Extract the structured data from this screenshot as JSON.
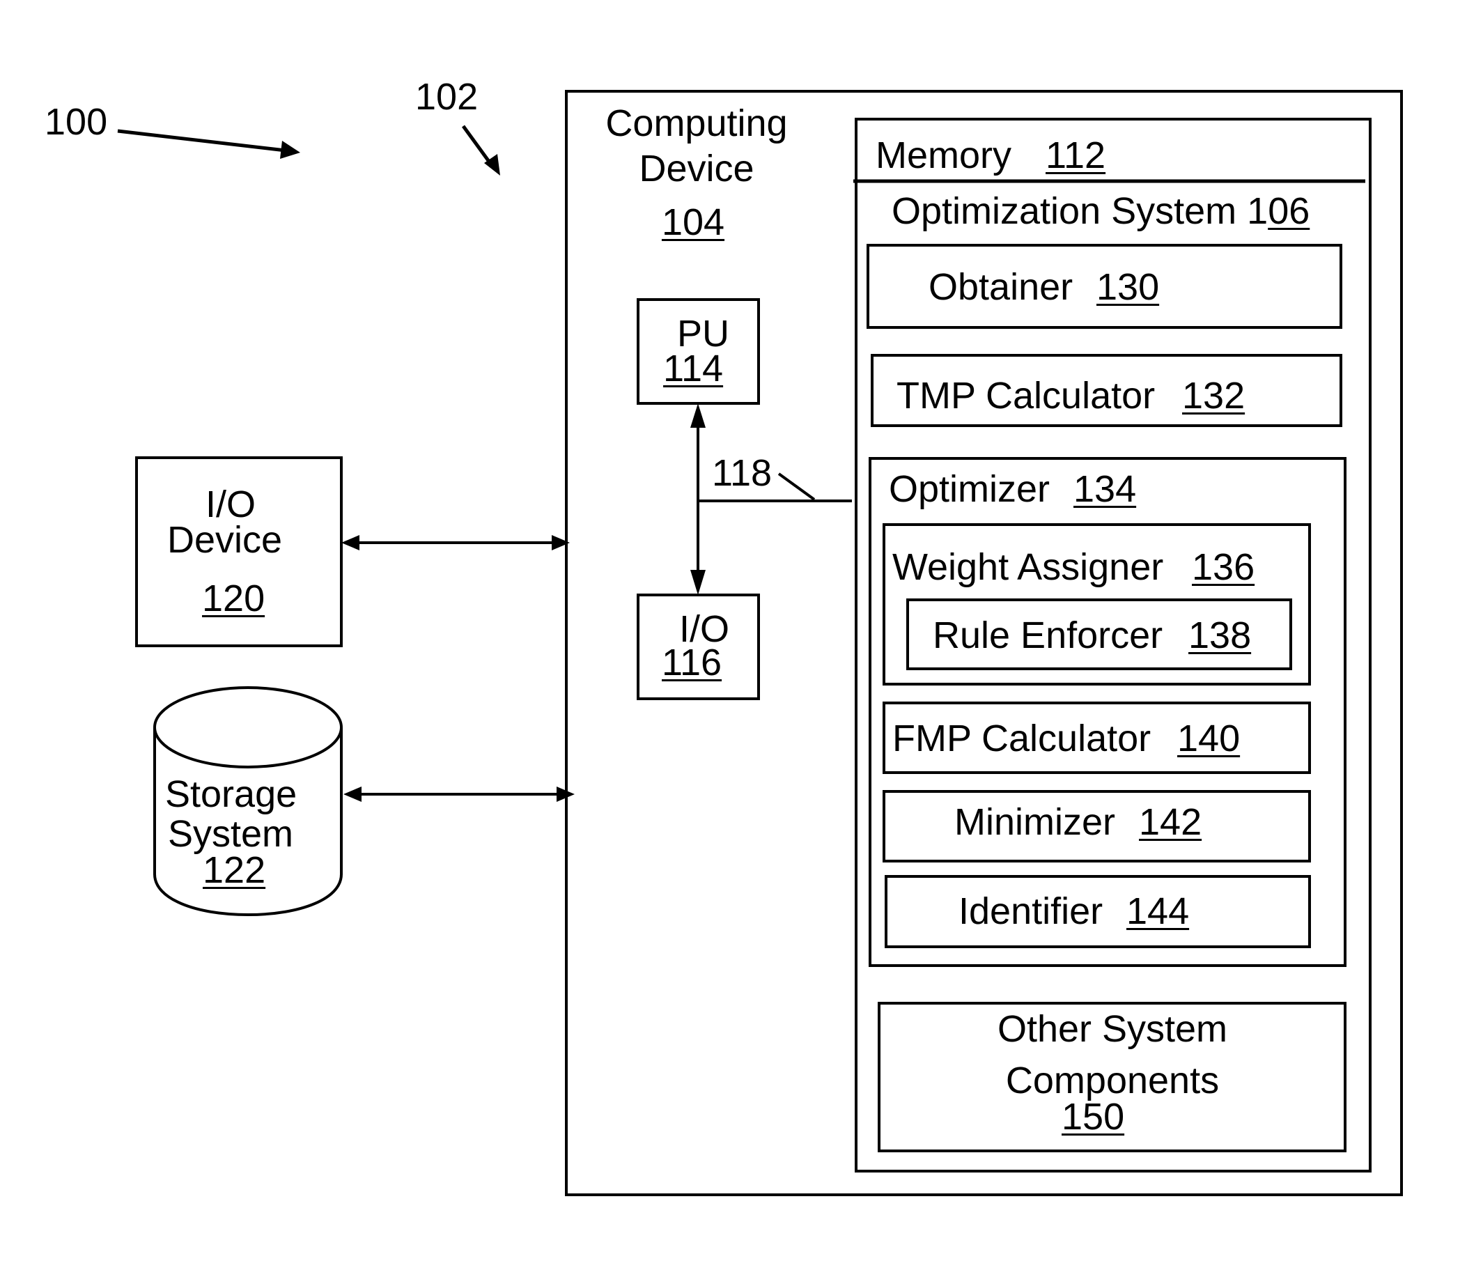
{
  "figure": {
    "ref_system": "100",
    "ref_environment": "102"
  },
  "computing_device": {
    "label_line1": "Computing",
    "label_line2": "Device",
    "ref": "104"
  },
  "processing_unit": {
    "label": "PU",
    "ref": "114"
  },
  "io_unit": {
    "label": "I/O",
    "ref": "116"
  },
  "bus": {
    "ref": "118"
  },
  "memory": {
    "label": "Memory",
    "ref": "112"
  },
  "optimization_system": {
    "label": "Optimization  System 1",
    "ref": "06"
  },
  "obtainer": {
    "label": "Obtainer",
    "ref": "130"
  },
  "tmp_calculator": {
    "label": "TMP Calculator",
    "ref": "132"
  },
  "optimizer": {
    "label": "Optimizer",
    "ref": "134"
  },
  "weight_assigner": {
    "label": "Weight Assigner",
    "ref": "136"
  },
  "rule_enforcer": {
    "label": "Rule Enforcer",
    "ref": "138"
  },
  "fmp_calculator": {
    "label": "FMP Calculator",
    "ref": "140"
  },
  "minimizer": {
    "label": "Minimizer",
    "ref": "142"
  },
  "identifier": {
    "label": "Identifier",
    "ref": "144"
  },
  "other_components": {
    "label_line1": "Other System",
    "label_line2": "Components",
    "ref": "150"
  },
  "io_device": {
    "label_line1": "I/O",
    "label_line2": "Device",
    "ref": "120"
  },
  "storage_system": {
    "label_line1": "Storage",
    "label_line2": "System",
    "ref": "122"
  }
}
